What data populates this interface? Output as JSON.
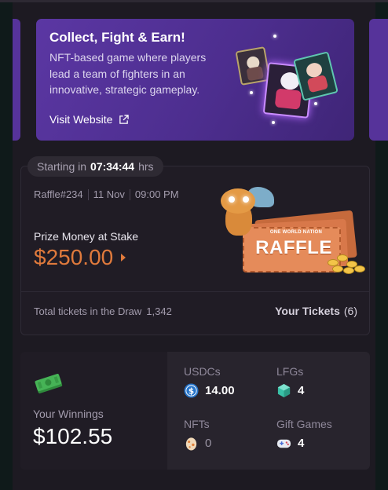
{
  "banner": {
    "title": "Collect, Fight & Earn!",
    "description": "NFT-based game where players lead a team of fighters in an innovative, strategic gameplay.",
    "visit_label": "Visit Website"
  },
  "raffle": {
    "starting_prefix": "Starting in",
    "timer": "07:34:44",
    "timer_unit": "hrs",
    "id": "Raffle#234",
    "date": "11 Nov",
    "time": "09:00 PM",
    "prize_label": "Prize Money at Stake",
    "prize_value": "$250.00",
    "art_subtitle": "ONE WORLD NATION",
    "art_title": "RAFFLE",
    "total_label": "Total tickets in the Draw",
    "total_value": "1,342",
    "your_tickets_label": "Your Tickets",
    "your_tickets_count": "(6)"
  },
  "winnings": {
    "label": "Your Winnings",
    "value": "$102.55",
    "stats": {
      "usdc": {
        "label": "USDCs",
        "value": "14.00",
        "icon": "usdc-coin-icon"
      },
      "lfg": {
        "label": "LFGs",
        "value": "4",
        "icon": "lfg-gem-icon"
      },
      "nft": {
        "label": "NFTs",
        "value": "0",
        "icon": "egg-icon"
      },
      "gift": {
        "label": "Gift Games",
        "value": "4",
        "icon": "gamepad-icon"
      }
    }
  },
  "colors": {
    "accent_orange": "#e07a3c",
    "banner_purple": "#56339a",
    "background": "#1d1a22"
  }
}
